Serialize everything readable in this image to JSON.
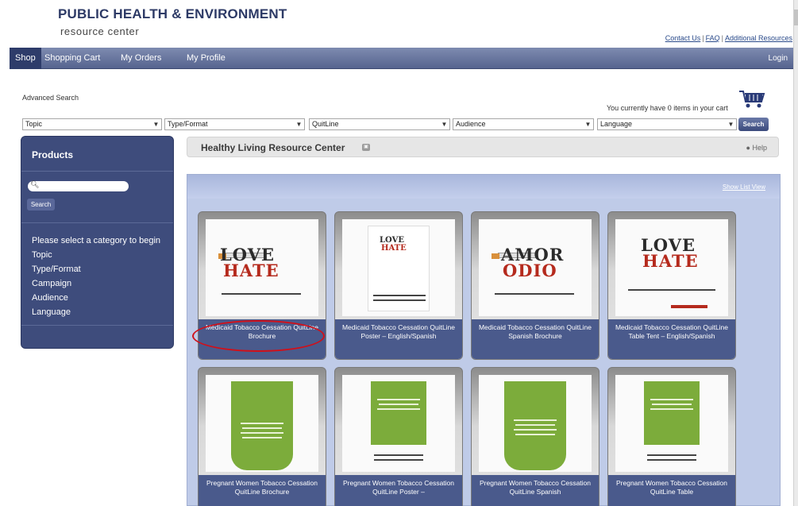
{
  "header": {
    "title": "PUBLIC HEALTH & ENVIRONMENT",
    "subtitle": "resource center",
    "links": [
      "Contact Us",
      "FAQ",
      "Additional Resources"
    ]
  },
  "nav": {
    "items": [
      "Shop",
      "Shopping Cart",
      "My Orders",
      "My Profile"
    ],
    "login": "Login"
  },
  "search": {
    "advanced": "Advanced Search",
    "cart_message": "You currently have 0 items in your cart",
    "filters": [
      "Topic",
      "Type/Format",
      "QuitLine",
      "Audience",
      "Language"
    ],
    "button": "Search"
  },
  "sidebar": {
    "title": "Products",
    "search_button": "Search",
    "prompt": "Please select a category to begin",
    "categories": [
      "Topic",
      "Type/Format",
      "Campaign",
      "Audience",
      "Language"
    ]
  },
  "main": {
    "title": "Healthy Living Resource Center",
    "help": "Help",
    "show_list": "Show List View"
  },
  "products": [
    {
      "caption": "Medicaid Tobacco Cessation QuitLine Brochure",
      "top": "LOVE",
      "bottom": "HATE"
    },
    {
      "caption": "Medicaid Tobacco Cessation QuitLine Poster – English/Spanish",
      "top": "LOVE",
      "bottom": "HATE"
    },
    {
      "caption": "Medicaid Tobacco Cessation QuitLine Spanish Brochure",
      "top": "AMOR",
      "bottom": "ODIO"
    },
    {
      "caption": "Medicaid Tobacco Cessation QuitLine Table Tent – English/Spanish",
      "top": "LOVE",
      "bottom": "HATE"
    },
    {
      "caption": "Pregnant Women Tobacco Cessation QuitLine Brochure"
    },
    {
      "caption": "Pregnant Women Tobacco Cessation QuitLine Poster –"
    },
    {
      "caption": "Pregnant Women Tobacco Cessation QuitLine Spanish"
    },
    {
      "caption": "Pregnant Women Tobacco Cessation QuitLine Table"
    }
  ],
  "colors": {
    "nav": "#56648f",
    "sidebar": "#3e4c7c",
    "panel": "#bfcbe8",
    "caption": "#4a5a8c",
    "highlight": "#d0101a"
  }
}
